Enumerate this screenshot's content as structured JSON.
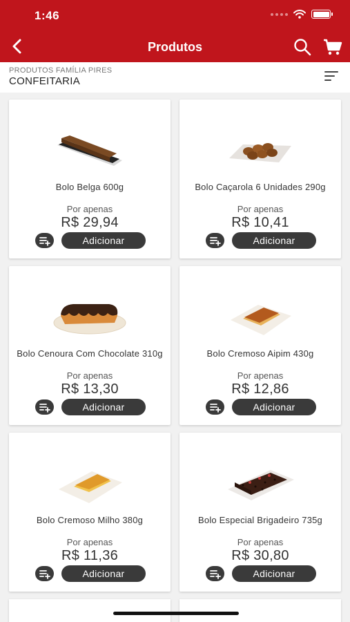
{
  "status_bar": {
    "time": "1:46"
  },
  "nav": {
    "title": "Produtos"
  },
  "subheader": {
    "store": "PRODUTOS FAMÍLIA PIRES",
    "category": "CONFEITARIA"
  },
  "colors": {
    "brand": "#c0151c",
    "button": "#3a3a3a"
  },
  "products": [
    {
      "name": "Bolo Belga 600g",
      "price_label": "Por apenas",
      "price": "R$ 29,94",
      "button": "Adicionar",
      "image": "chocolate-loaf-cake"
    },
    {
      "name": "Bolo Caçarola 6 Unidades 290g",
      "price_label": "Por apenas",
      "price": "R$ 10,41",
      "button": "Adicionar",
      "image": "mini-cupcakes"
    },
    {
      "name": "Bolo Cenoura Com Chocolate 310g",
      "price_label": "Por apenas",
      "price": "R$ 13,30",
      "button": "Adicionar",
      "image": "carrot-cake-chocolate"
    },
    {
      "name": "Bolo Cremoso Aipim 430g",
      "price_label": "Por apenas",
      "price": "R$ 12,86",
      "button": "Adicionar",
      "image": "cassava-cake"
    },
    {
      "name": "Bolo Cremoso Milho 380g",
      "price_label": "Por apenas",
      "price": "R$ 11,36",
      "button": "Adicionar",
      "image": "corn-cake"
    },
    {
      "name": "Bolo Especial Brigadeiro 735g",
      "price_label": "Por apenas",
      "price": "R$ 30,80",
      "button": "Adicionar",
      "image": "brigadeiro-cake"
    }
  ]
}
